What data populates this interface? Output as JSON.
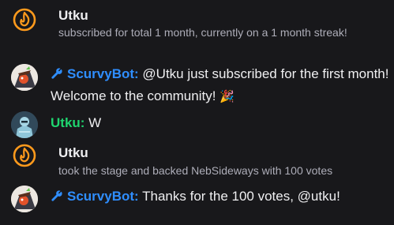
{
  "colors": {
    "background": "#18181b",
    "sub_icon": "#ff9a1c",
    "bot_name": "#2f8eff",
    "user_name": "#1fd56f",
    "muted_text": "#adadb8"
  },
  "messages": [
    {
      "kind": "subscription",
      "icon": "subscription-flame-icon",
      "username": "Utku",
      "detail": "subscribed for total 1 month, currently on a 1 month streak!"
    },
    {
      "kind": "chat",
      "badge_icon": "wrench-icon",
      "avatar": "scurvybot-avatar",
      "username": "ScurvyBot",
      "separator": ":",
      "text": " @Utku just subscribed for the first month! Welcome to the community! ",
      "emote": "🎉"
    },
    {
      "kind": "chat",
      "avatar": "utku-avatar",
      "username": "Utku",
      "separator": ":",
      "text": " W"
    },
    {
      "kind": "stage",
      "icon": "subscription-flame-icon",
      "username": "Utku",
      "detail": "took the stage and backed NebSideways with 100 votes"
    },
    {
      "kind": "chat",
      "badge_icon": "wrench-icon",
      "avatar": "scurvybot-avatar",
      "username": "ScurvyBot",
      "separator": ":",
      "text": " Thanks for the 100 votes, @utku!"
    }
  ]
}
